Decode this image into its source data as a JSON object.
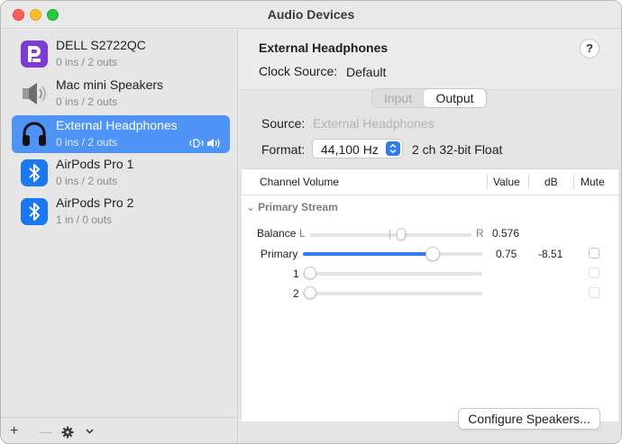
{
  "window": {
    "title": "Audio Devices"
  },
  "sidebar": {
    "devices": [
      {
        "name": "DELL S2722QC",
        "io": "0 ins / 2 outs",
        "icon": "dell-display-icon"
      },
      {
        "name": "Mac mini Speakers",
        "io": "0 ins / 2 outs",
        "icon": "speaker-icon"
      },
      {
        "name": "External Headphones",
        "io": "0 ins / 2 outs",
        "icon": "headphones-icon",
        "selected": true
      },
      {
        "name": "AirPods Pro 1",
        "io": "0 ins / 2 outs",
        "icon": "bluetooth-icon"
      },
      {
        "name": "AirPods Pro 2",
        "io": "1 in / 0 outs",
        "icon": "bluetooth-icon"
      }
    ],
    "footer": {
      "add": "+",
      "remove": "—"
    }
  },
  "detail": {
    "title": "External Headphones",
    "help": "?",
    "clock_label": "Clock Source:",
    "clock_value": "Default",
    "tabs": {
      "input": "Input",
      "output": "Output",
      "selected": "Output"
    },
    "source_label": "Source:",
    "source_value": "External Headphones",
    "format_label": "Format:",
    "format_rate": "44,100 Hz",
    "format_extra": "2 ch 32-bit Float"
  },
  "table": {
    "headers": {
      "channel": "Channel Volume",
      "value": "Value",
      "db": "dB",
      "mute": "Mute"
    },
    "stream": "Primary Stream",
    "balance": {
      "label": "Balance",
      "left": "L",
      "right": "R",
      "value": "0.576"
    },
    "primary": {
      "label": "Primary",
      "value": "0.75",
      "db": "-8.51"
    },
    "channels": [
      "1",
      "2"
    ]
  },
  "configure_button": "Configure Speakers...",
  "colors": {
    "accent": "#2f7bf0",
    "selection": "#4f93f7"
  }
}
